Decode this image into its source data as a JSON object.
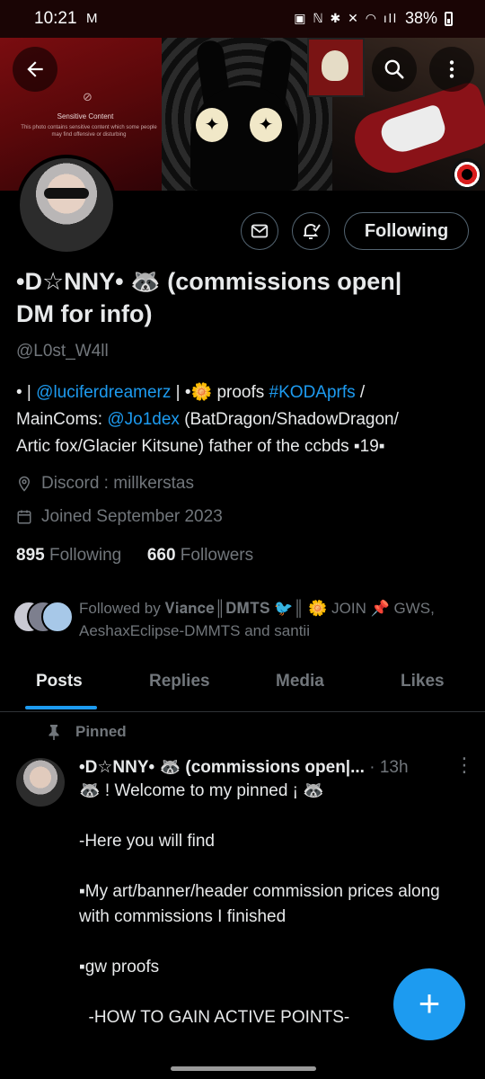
{
  "status_bar": {
    "time": "10:21",
    "battery": "38%"
  },
  "banner": {
    "sensitive_title": "Sensitive Content",
    "sensitive_text": "This photo contains sensitive content which some people may find offensive or disturbing"
  },
  "profile": {
    "name_line1": "•D☆NNY• 🦝 (commissions open|",
    "name_line2": "DM for info)",
    "handle": "@L0st_W4ll",
    "bio": {
      "part1": "• | ",
      "link1": "@luciferdreamerz",
      "part2": " | •🌼  proofs ",
      "link2": "#KODAprfs",
      "part3": " /",
      "part4": "MainComs: ",
      "link3": "@Jo1dex",
      "part5": " (BatDragon/ShadowDragon/",
      "line3": "Artic fox/Glacier Kitsune) father of the ccbds ▪19▪"
    },
    "location": "Discord : millkerstas",
    "joined": "Joined September 2023",
    "following_count": "895",
    "following_label": "Following",
    "followers_count": "660",
    "followers_label": "Followers",
    "followed_by_line1": "Followed by 𝐕𝐢𝐚𝐧𝐜𝐞║𝐃𝐌𝐓𝐒 🐦║ 🌼 JOIN 📌 GWS,",
    "followed_by_line2": "AeshaxEclipse-DMMTS and santii"
  },
  "actions": {
    "following_button": "Following"
  },
  "tabs": [
    "Posts",
    "Replies",
    "Media",
    "Likes"
  ],
  "post": {
    "pinned_label": "Pinned",
    "author": "•D☆NNY• 🦝 (commissions open|...",
    "time": "· 13h",
    "lines": [
      "🦝 ! Welcome to my pinned ¡ 🦝",
      "",
      "-Here you will find",
      "",
      "▪My art/banner/header commission prices along with commissions I finished",
      "",
      "▪gw proofs",
      "",
      "  -HOW TO GAIN ACTIVE POINTS-"
    ]
  },
  "colors": {
    "accent": "#1d9bf0",
    "background": "#000000",
    "text": "#e7e9ea",
    "muted": "#71767b"
  },
  "icons": [
    "back-arrow-icon",
    "search-icon",
    "more-vertical-icon",
    "mail-icon",
    "bell-notify-icon",
    "location-icon",
    "calendar-icon",
    "pin-icon",
    "compose-plus-icon"
  ]
}
